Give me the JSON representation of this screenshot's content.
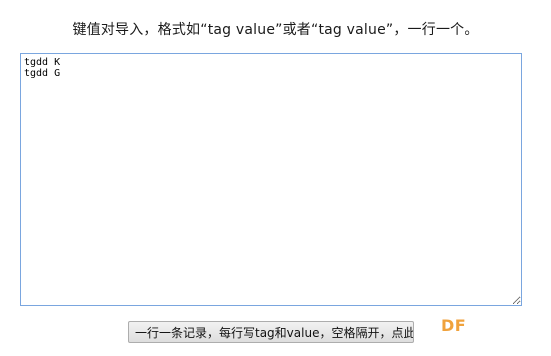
{
  "instructions": "键值对导入，格式如“tag value”或者“tag value”，一行一个。",
  "textarea": {
    "value": "tgdd K\ntgdd G"
  },
  "submit_button": {
    "label": "一行一条记录，每行写tag和value，空格隔开，点此提交"
  },
  "watermark": {
    "text": "DF",
    "color": "#f0a23c"
  },
  "colors": {
    "textarea_border": "#7aa6df"
  }
}
